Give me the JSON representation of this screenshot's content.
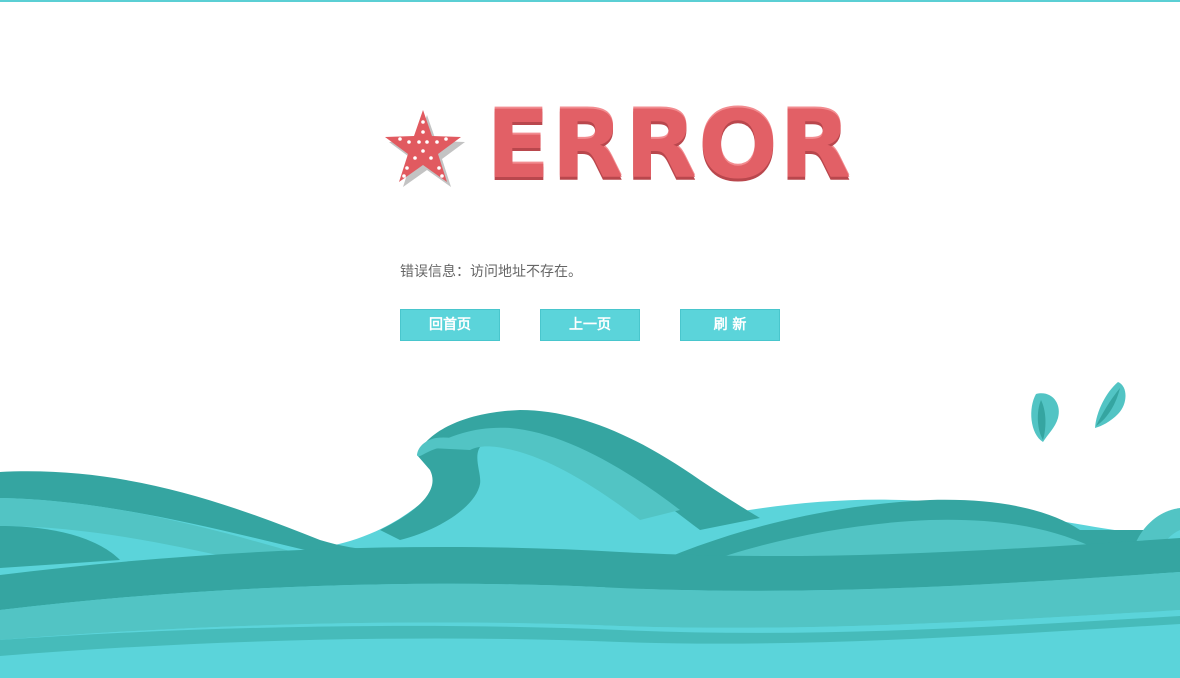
{
  "page": {
    "heading": "ERROR",
    "error_label": "错误信息",
    "error_separator": "：",
    "error_detail": "访问地址不存在。"
  },
  "buttons": {
    "home": "回首页",
    "back": "上一页",
    "refresh": "刷 新"
  },
  "colors": {
    "accent": "#5bd4da",
    "wave_dark": "#35a5a1",
    "wave_mid": "#52c4c4",
    "wave_light": "#5bd4da",
    "error_red": "#e26066"
  },
  "icons": {
    "starfish": "starfish-icon",
    "waves": "ocean-waves-illustration",
    "droplets": "water-droplet-icon"
  }
}
